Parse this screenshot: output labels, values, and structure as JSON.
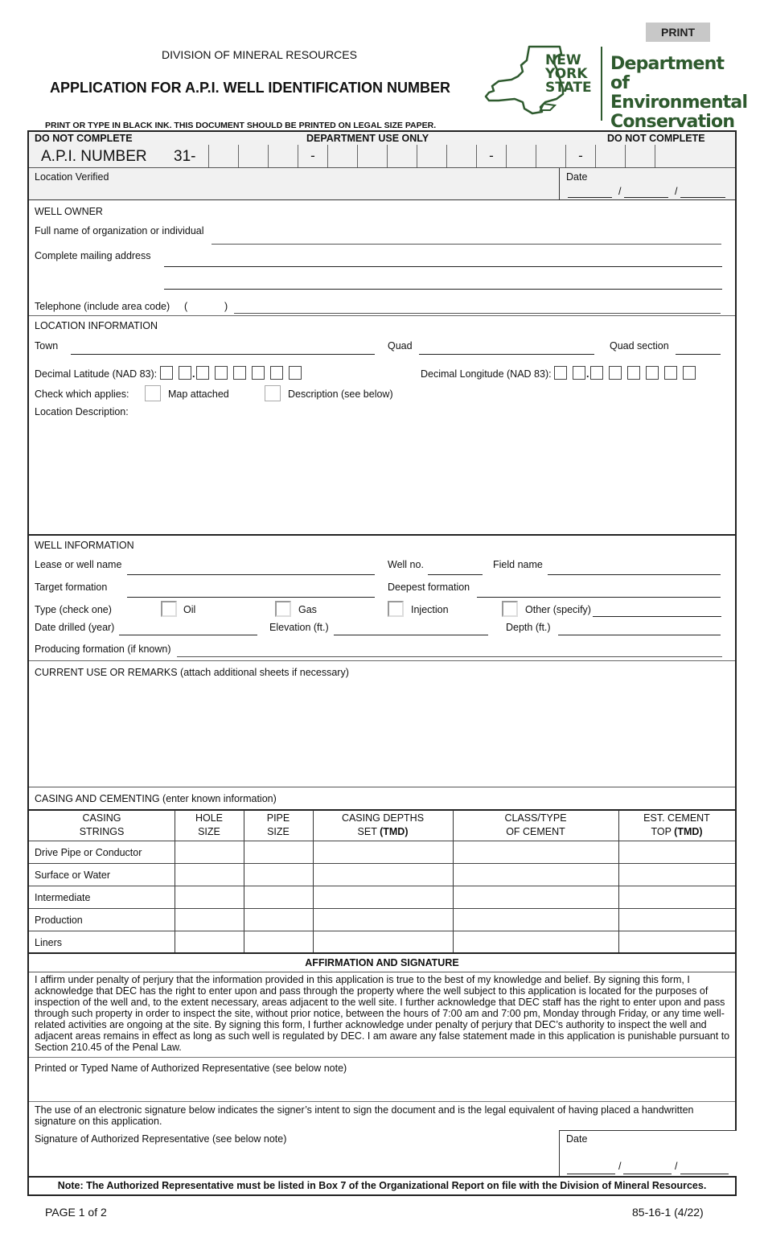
{
  "header": {
    "print_label": "PRINT",
    "division": "DIVISION OF MINERAL RESOURCES",
    "title": "APPLICATION FOR A.P.I. WELL IDENTIFICATION NUMBER",
    "instruction": "PRINT OR TYPE IN BLACK INK. THIS DOCUMENT SHOULD BE PRINTED ON LEGAL SIZE PAPER.",
    "logo": {
      "state_line1": "NEW",
      "state_line2": "YORK",
      "state_line3": "STATE",
      "dept_line1": "Department of",
      "dept_line2": "Environmental",
      "dept_line3": "Conservation",
      "color": "#2e5a2e"
    }
  },
  "dept_use": {
    "left_label": "DO NOT COMPLETE",
    "center_label": "DEPARTMENT USE ONLY",
    "right_label": "DO NOT COMPLETE",
    "api_label": "A.P.I. NUMBER",
    "api_prefix": "31-",
    "separators": [
      "-",
      "-",
      "-"
    ],
    "location_verified": "Location Verified",
    "date_label": "Date",
    "date_sep": "/"
  },
  "well_owner": {
    "section": "WELL OWNER",
    "full_name_label": "Full name of organization or individual",
    "full_name_value": "",
    "address_label": "Complete mailing address",
    "address_line1": "",
    "address_line2": "",
    "telephone_label": "Telephone (include area code)",
    "paren_open": "(",
    "paren_close": ")",
    "area_code": "",
    "telephone_value": ""
  },
  "location": {
    "section": "LOCATION INFORMATION",
    "town_label": "Town",
    "town_value": "",
    "quad_label": "Quad",
    "quad_value": "",
    "quad_section_label": "Quad section",
    "quad_section_value": "",
    "lat_label": "Decimal Latitude (NAD 83):",
    "lon_label": "Decimal Longitude (NAD 83):",
    "decimal_point": ".",
    "check_label": "Check which applies:",
    "map_attached": "Map attached",
    "description_option": "Description (see below)",
    "map_attached_checked": false,
    "description_checked": false,
    "description_label": "Location Description:",
    "description_value": ""
  },
  "well_info": {
    "section": "WELL INFORMATION",
    "lease_label": "Lease or well name",
    "well_no_label": "Well no.",
    "field_name_label": "Field name",
    "target_label": "Target formation",
    "deepest_label": "Deepest formation",
    "type_label": "Type (check one)",
    "types": [
      {
        "label": "Oil",
        "checked": false
      },
      {
        "label": "Gas",
        "checked": false
      },
      {
        "label": "Injection",
        "checked": false
      },
      {
        "label": "Other (specify)",
        "checked": false
      }
    ],
    "date_drilled_label": "Date drilled (year)",
    "elevation_label": "Elevation (ft.)",
    "depth_label": "Depth (ft.)",
    "producing_label": "Producing formation (if known)"
  },
  "remarks": {
    "label": "CURRENT USE OR REMARKS (attach additional sheets if necessary)",
    "value": ""
  },
  "casing": {
    "section": "CASING AND CEMENTING (enter known information)",
    "headers": [
      {
        "line1": "CASING",
        "line2": "STRINGS",
        "bold2": ""
      },
      {
        "line1": "HOLE",
        "line2": "SIZE",
        "bold2": ""
      },
      {
        "line1": "PIPE",
        "line2": "SIZE",
        "bold2": ""
      },
      {
        "line1": "CASING DEPTHS",
        "line2": "SET ",
        "bold2": "(TMD)"
      },
      {
        "line1": "CLASS/TYPE",
        "line2": "OF CEMENT",
        "bold2": ""
      },
      {
        "line1": "EST. CEMENT",
        "line2": "TOP ",
        "bold2": "(TMD)"
      }
    ],
    "rows": [
      [
        "Drive Pipe or Conductor",
        "",
        "",
        "",
        "",
        ""
      ],
      [
        "Surface or Water",
        "",
        "",
        "",
        "",
        ""
      ],
      [
        "Intermediate",
        "",
        "",
        "",
        "",
        ""
      ],
      [
        "Production",
        "",
        "",
        "",
        "",
        ""
      ],
      [
        "Liners",
        "",
        "",
        "",
        "",
        ""
      ]
    ]
  },
  "affirmation": {
    "title": "AFFIRMATION AND SIGNATURE",
    "text": "I affirm under penalty of perjury that the information provided in this application is true to the best of my knowledge and belief. By signing this form, I acknowledge that DEC has the right to enter upon and pass through the property where the well subject to this application is located for the purposes of inspection of the well and, to the extent necessary, areas adjacent to the well site. I further acknowledge that DEC staff has the right to enter upon and pass through such property in order to inspect the site, without prior notice, between the hours of 7:00 am and 7:00 pm, Monday through Friday, or any time well-related activities are ongoing at the site. By signing this form, I further acknowledge under penalty of perjury that DEC’s authority to inspect the well and adjacent areas remains in effect as long as such well is regulated by DEC. I am aware any false statement made in this application is punishable pursuant to Section 210.45 of the Penal Law.",
    "printed_name_label": "Printed or Typed Name of Authorized Representative (see below note)",
    "esig_text": "The use of an electronic signature below indicates the signer’s intent to sign the document and is the legal equivalent of having placed a handwritten signature on this application.",
    "signature_label": "Signature of Authorized Representative (see below note)",
    "date_label": "Date",
    "date_sep": "/",
    "note": "Note: The Authorized Representative must be listed in Box 7 of the Organizational Report on file with the Division of Mineral Resources."
  },
  "footer": {
    "page": "PAGE 1 of 2",
    "form_id": "85-16-1 (4/22)"
  }
}
